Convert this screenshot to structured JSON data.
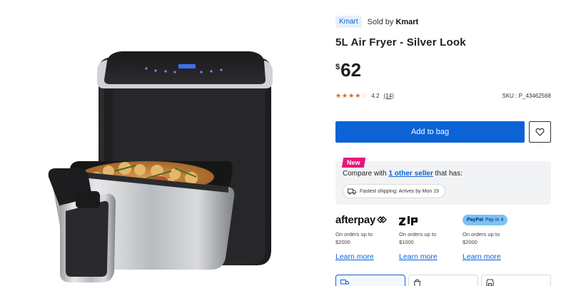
{
  "product": {
    "brand_chip": "Kmart",
    "sold_by_prefix": "Sold by",
    "sold_by_name": "Kmart",
    "title": "5L Air Fryer - Silver Look",
    "currency": "$",
    "price": "62",
    "rating_value": "4.2",
    "rating_count": "(14)",
    "stars": 4.2,
    "sku": "SKU : P_43462568"
  },
  "actions": {
    "add_to_bag": "Add to bag",
    "wishlist_icon": "heart-icon"
  },
  "compare": {
    "badge": "New",
    "prefix": "Compare with ",
    "link": "1 other seller",
    "suffix": " that has:",
    "shipping": "Fastest shipping: Arrives by Mon 19",
    "shipping_icon": "truck-icon"
  },
  "payments": [
    {
      "logo": "afterpay",
      "note_line1": "On orders up to",
      "note_line2": "$2000",
      "learn": "Learn more"
    },
    {
      "logo": "zip",
      "note_line1": "On orders up to",
      "note_line2": "$1000",
      "learn": "Learn more"
    },
    {
      "logo": "PayPal",
      "logo_sub": "Pay in 4",
      "note_line1": "On orders up to",
      "note_line2": "$2000",
      "learn": "Learn more"
    }
  ],
  "delivery_tabs": [
    "delivery-truck-icon",
    "click-collect-bag-icon",
    "store-icon"
  ],
  "colors": {
    "primary": "#0b63d6",
    "star": "#e0611a",
    "new_badge": "#e6177a",
    "paypal_pill": "#79c3f5"
  }
}
